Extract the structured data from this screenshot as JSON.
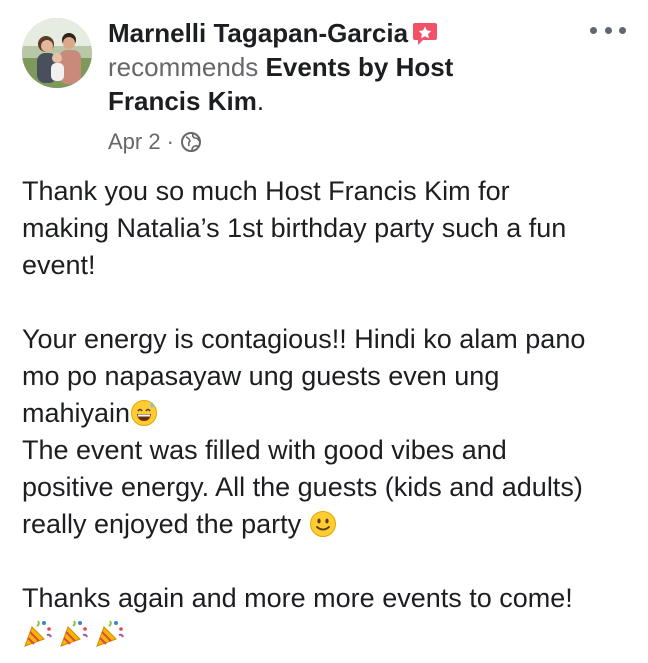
{
  "post": {
    "author": "Marnelli Tagapan-Garcia",
    "recommends_text": "recommends",
    "page_name_line1": "Events by Host",
    "page_name_line2": "Francis Kim",
    "period": ".",
    "date": "Apr 2",
    "separator": "·",
    "privacy_icon": "globe-icon",
    "recommend_icon": "recommend-star-icon",
    "menu_icon": "more-options-icon"
  },
  "body": {
    "para1_line1": "Thank you so much Host Francis Kim for",
    "para1_line2": "making Natalia’s 1st birthday party such a fun",
    "para1_line3": "event!",
    "para2_line1": "Your energy is contagious!! Hindi ko alam pano",
    "para2_line2": "mo po napasayaw ung guests even ung",
    "para2_line3": "mahiyain",
    "para3_line1": "The event was filled with good vibes and",
    "para3_line2": "positive energy. All the guests (kids and adults)",
    "para3_line3": "really enjoyed the party ",
    "para4_line1": "Thanks again and more more events to come!"
  },
  "emojis": {
    "sweat_smile": "grinning-sweat-emoji",
    "smile": "slightly-smiling-emoji",
    "party": "party-popper-emoji"
  },
  "colors": {
    "text": "#1c1e21",
    "muted": "#65676b",
    "recommend_badge": "#f25268"
  }
}
